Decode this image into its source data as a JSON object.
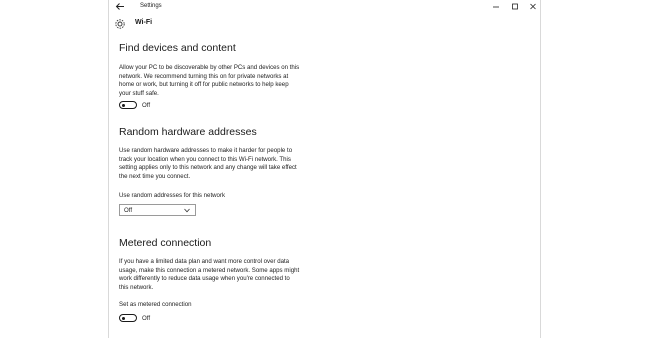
{
  "window": {
    "app_title": "Settings",
    "page_title": "Wi-Fi"
  },
  "sections": {
    "find": {
      "title": "Find devices and content",
      "lines": [
        "Allow your PC to be discoverable by other PCs and devices on this",
        "network. We recommend turning this on for private networks at",
        "home or work, but turning it off for public networks to help keep",
        "your stuff safe."
      ],
      "toggle_label": "Off"
    },
    "random": {
      "title": "Random hardware addresses",
      "lines": [
        "Use random hardware addresses to make it harder for people to",
        "track your location when you connect to this Wi-Fi network. This",
        "setting applies only to this network and any change will take effect",
        "the next time you connect."
      ],
      "select_label": "Use random addresses for this network",
      "select_value": "Off"
    },
    "metered": {
      "title": "Metered connection",
      "lines": [
        "If you have a limited data plan and want more control over data",
        "usage, make this connection a metered network. Some apps might",
        "work differently to reduce data usage when you're connected to",
        "this network."
      ],
      "toggle_caption": "Set as metered connection",
      "toggle_label": "Off"
    }
  }
}
